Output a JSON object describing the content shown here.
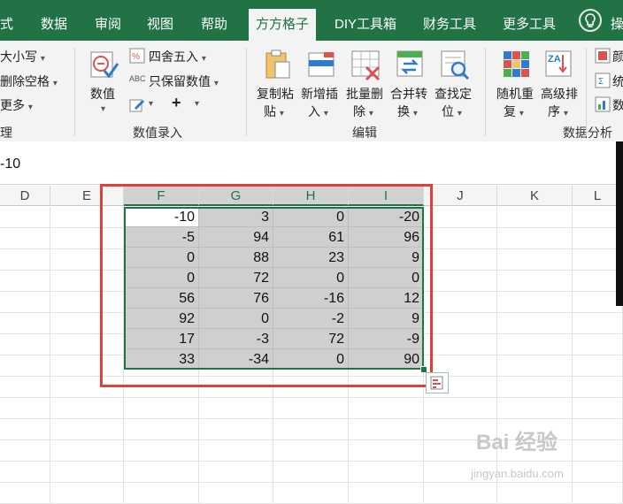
{
  "tabs": [
    {
      "label": "式"
    },
    {
      "label": "数据"
    },
    {
      "label": "审阅"
    },
    {
      "label": "视图"
    },
    {
      "label": "帮助"
    },
    {
      "label": "方方格子",
      "active": true
    },
    {
      "label": "DIY工具箱"
    },
    {
      "label": "财务工具"
    },
    {
      "label": "更多工具"
    }
  ],
  "tab_overflow": "操",
  "ribbon": {
    "group1": {
      "items": [
        "大小写",
        "删除空格",
        "更多"
      ],
      "label": "理"
    },
    "group2": {
      "big_button": "数值",
      "items": [
        "四舍五入",
        "只保留数值"
      ],
      "abc_text": "ABC",
      "plus_text": "+",
      "label": "数值录入"
    },
    "group3": {
      "buttons": [
        {
          "line1": "复制粘",
          "line2": "贴"
        },
        {
          "line1": "新增插",
          "line2": "入"
        },
        {
          "line1": "批量删",
          "line2": "除"
        },
        {
          "line1": "合并转",
          "line2": "换"
        },
        {
          "line1": "查找定",
          "line2": "位"
        }
      ],
      "label": "编辑"
    },
    "group4": {
      "buttons": [
        {
          "line1": "随机重",
          "line2": "复"
        },
        {
          "line1": "高级排",
          "line2": "序"
        }
      ],
      "label": "数据分析",
      "sort_icon_text": "ZA"
    },
    "group5": {
      "items": [
        "颜",
        "统",
        "数"
      ]
    }
  },
  "formula_bar": {
    "value": "-10"
  },
  "columns": [
    "D",
    "E",
    "F",
    "G",
    "H",
    "I",
    "J",
    "K",
    "L"
  ],
  "grid": {
    "rows": [
      [
        "-10",
        "3",
        "0",
        "-20"
      ],
      [
        "-5",
        "94",
        "61",
        "96"
      ],
      [
        "0",
        "88",
        "23",
        "9"
      ],
      [
        "0",
        "72",
        "0",
        "0"
      ],
      [
        "56",
        "76",
        "-16",
        "12"
      ],
      [
        "92",
        "0",
        "-2",
        "9"
      ],
      [
        "17",
        "-3",
        "72",
        "-9"
      ],
      [
        "33",
        "-34",
        "0",
        "90"
      ]
    ]
  },
  "accent": "#217346",
  "highlight": "#e0403a",
  "watermark": {
    "text": "Bai 经验",
    "sub": "jingyan.baidu.com"
  }
}
